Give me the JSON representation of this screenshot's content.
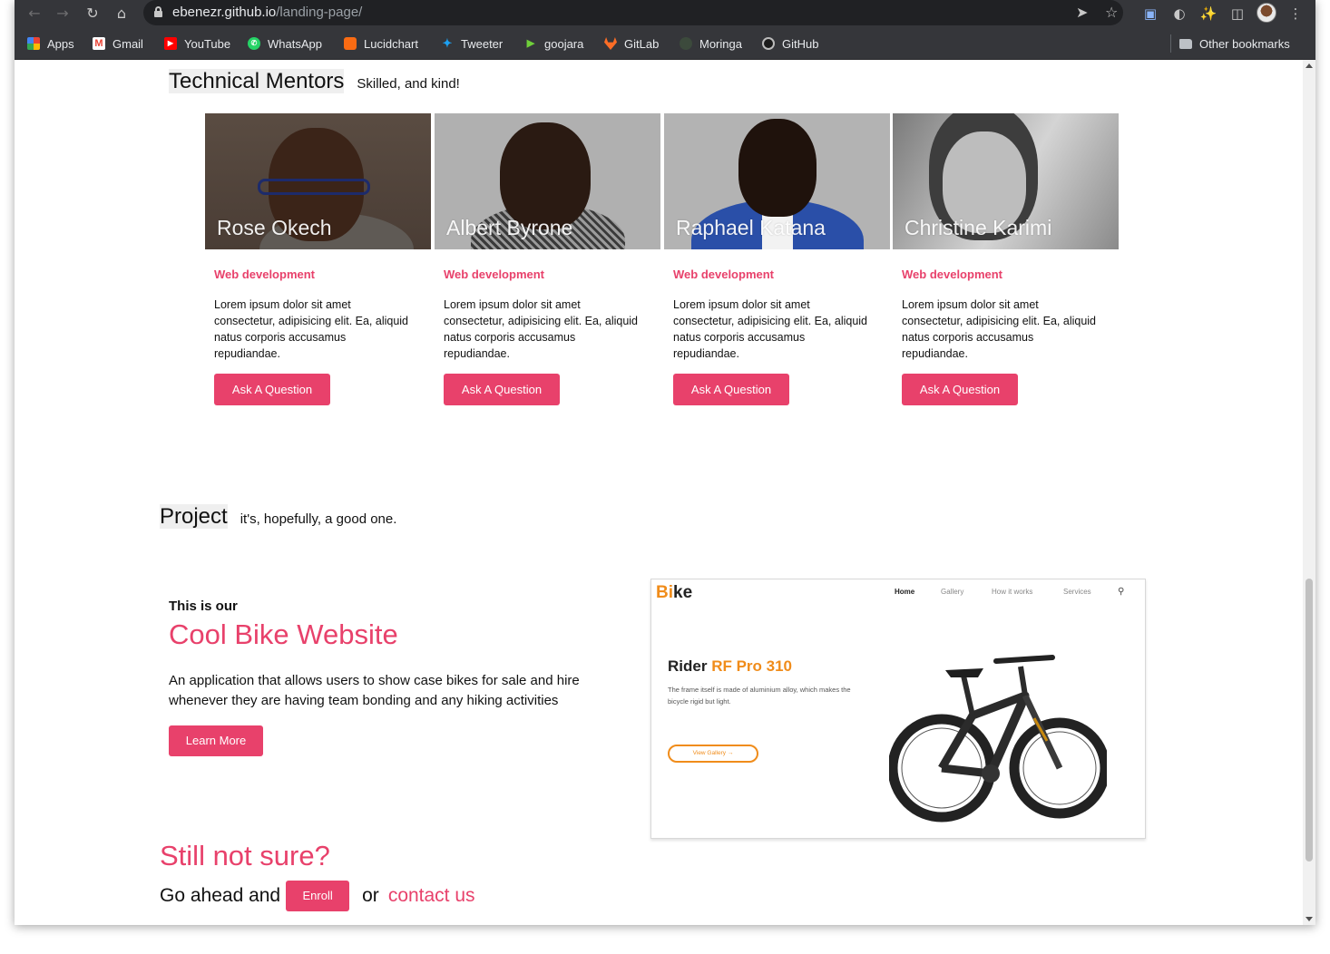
{
  "browser": {
    "url_host": "ebenezr.github.io",
    "url_path": "/landing-page/"
  },
  "bookmarks": [
    {
      "label": "Apps",
      "icon": "apps-grid-icon"
    },
    {
      "label": "Gmail",
      "icon": "gmail-icon"
    },
    {
      "label": "YouTube",
      "icon": "youtube-icon"
    },
    {
      "label": "WhatsApp",
      "icon": "whatsapp-icon"
    },
    {
      "label": "Lucidchart",
      "icon": "lucidchart-icon"
    },
    {
      "label": "Tweeter",
      "icon": "twitter-icon"
    },
    {
      "label": "goojara",
      "icon": "goojara-icon"
    },
    {
      "label": "GitLab",
      "icon": "gitlab-icon"
    },
    {
      "label": "Moringa",
      "icon": "moringa-icon"
    },
    {
      "label": "GitHub",
      "icon": "github-icon"
    }
  ],
  "other_bookmarks": "Other bookmarks",
  "mentors_section": {
    "title": "Technical Mentors",
    "subtitle": "Skilled, and kind!",
    "mentors": [
      {
        "name": "Rose Okech",
        "role": "Web development",
        "bio": "Lorem ipsum dolor sit amet consectetur, adipisicing elit. Ea, aliquid natus corporis accusamus repudiandae.",
        "button": "Ask A Question"
      },
      {
        "name": "Albert Byrone",
        "role": "Web development",
        "bio": "Lorem ipsum dolor sit amet consectetur, adipisicing elit. Ea, aliquid natus corporis accusamus repudiandae.",
        "button": "Ask A Question"
      },
      {
        "name": "Raphael Katana",
        "role": "Web development",
        "bio": "Lorem ipsum dolor sit amet consectetur, adipisicing elit. Ea, aliquid natus corporis accusamus repudiandae.",
        "button": "Ask A Question"
      },
      {
        "name": "Christine Karimi",
        "role": "Web development",
        "bio": "Lorem ipsum dolor sit amet consectetur, adipisicing elit. Ea, aliquid natus corporis accusamus repudiandae.",
        "button": "Ask A Question"
      }
    ]
  },
  "project_section": {
    "title": "Project",
    "subtitle": "it's, hopefully, a good one.",
    "intro": "This is our",
    "name": "Cool Bike Website",
    "description": "An application that allows users to show case bikes for sale and hire whenever they are having team bonding and any hiking activities",
    "button": "Learn More",
    "preview": {
      "logo_b": "Bi",
      "logo_rest": "ke",
      "nav": [
        "Home",
        "Gallery",
        "How it works",
        "Services"
      ],
      "headline_plain": "Rider ",
      "headline_accent": "RF Pro 310",
      "text": "The frame itself is made of aluminium alloy, which makes the bicycle rigid but light.",
      "button": "View Gallery  →"
    }
  },
  "cta": {
    "heading": "Still not sure?",
    "prefix": "Go ahead and",
    "enroll": "Enroll",
    "or": "or",
    "contact": "contact us"
  },
  "colors": {
    "accent": "#e8416b",
    "preview_orange": "#f08c1a",
    "chrome_dark": "#35363a"
  }
}
